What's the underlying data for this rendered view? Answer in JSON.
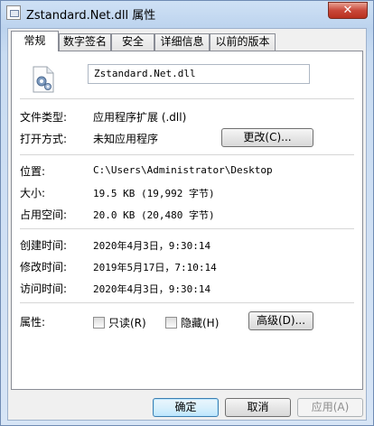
{
  "window": {
    "title": "Zstandard.Net.dll 属性",
    "close_label": "✕"
  },
  "tabs": [
    {
      "label": "常规",
      "active": true
    },
    {
      "label": "数字签名",
      "active": false
    },
    {
      "label": "安全",
      "active": false
    },
    {
      "label": "详细信息",
      "active": false
    },
    {
      "label": "以前的版本",
      "active": false
    }
  ],
  "file": {
    "name": "Zstandard.Net.dll",
    "icon": "dll-gear-file-icon"
  },
  "general": {
    "type_label": "文件类型:",
    "type_value": "应用程序扩展 (.dll)",
    "opens_label": "打开方式:",
    "opens_value": "未知应用程序",
    "change_button": "更改(C)...",
    "location_label": "位置:",
    "location_value": "C:\\Users\\Administrator\\Desktop",
    "size_label": "大小:",
    "size_value": "19.5 KB (19,992 字节)",
    "size_on_disk_label": "占用空间:",
    "size_on_disk_value": "20.0 KB (20,480 字节)",
    "created_label": "创建时间:",
    "created_value": "2020年4月3日，9:30:14",
    "modified_label": "修改时间:",
    "modified_value": "2019年5月17日，7:10:14",
    "accessed_label": "访问时间:",
    "accessed_value": "2020年4月3日，9:30:14",
    "attributes_label": "属性:",
    "readonly_label": "只读(R)",
    "hidden_label": "隐藏(H)",
    "advanced_button": "高级(D)..."
  },
  "footer": {
    "ok": "确定",
    "cancel": "取消",
    "apply": "应用(A)"
  },
  "colors": {
    "title_gradient_top": "#cfe1f5",
    "close_button": "#c9483a",
    "default_button_border": "#3c7fb1"
  }
}
